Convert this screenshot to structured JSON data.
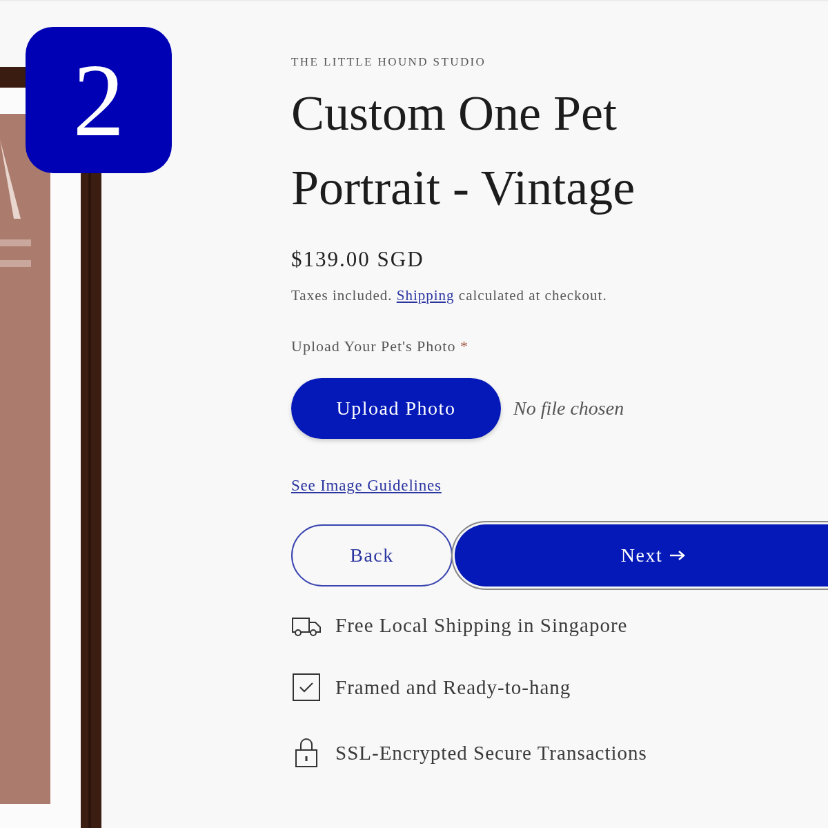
{
  "step_badge": "2",
  "product": {
    "vendor": "THE LITTLE HOUND STUDIO",
    "title_lines": [
      "Custom One Pet",
      "Portrait - Vintage"
    ],
    "price": "$139.00 SGD",
    "tax_note": {
      "before": "Taxes included.",
      "link": "Shipping",
      "after": "calculated at checkout."
    }
  },
  "upload": {
    "label": "Upload Your Pet's Photo",
    "required_mark": "*",
    "button": "Upload Photo",
    "file_status": "No file chosen",
    "guidelines_link": "See Image Guidelines"
  },
  "actions": [
    {
      "label": "Back",
      "kind": "outline"
    },
    {
      "label": "Next",
      "kind": "primary"
    }
  ],
  "features": [
    {
      "kind": "shipping",
      "text": "Free Local Shipping in Singapore"
    },
    {
      "kind": "framed",
      "text": "Framed and Ready-to-hang"
    },
    {
      "kind": "secure",
      "text": "SSL-Encrypted Secure Transactions"
    }
  ]
}
